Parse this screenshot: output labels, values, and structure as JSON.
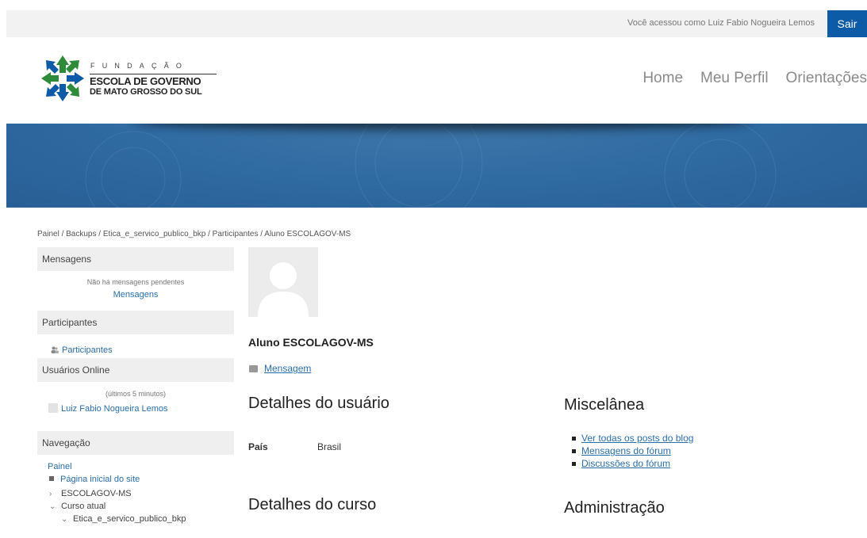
{
  "topbar": {
    "logged_in_text": "Você acessou como Luiz Fabio Nogueira Lemos",
    "logout_label": "Sair"
  },
  "logo": {
    "line_fundacao": "FUNDAÇÃO",
    "line_escola": "ESCOLA DE GOVERNO",
    "line_mato": "DE MATO GROSSO DO SUL"
  },
  "nav": {
    "home": "Home",
    "profile": "Meu Perfil",
    "guidance": "Orientações"
  },
  "breadcrumb": "Painel / Backups / Etica_e_servico_publico_bkp / Participantes / Aluno ESCOLAGOV-MS",
  "sidebar": {
    "messages": {
      "title": "Mensagens",
      "empty_text": "Não há mensagens pendentes",
      "link": "Mensagens"
    },
    "participants": {
      "title": "Participantes",
      "link": "Participantes"
    },
    "online": {
      "title": "Usuários Online",
      "window_text": "(últimos 5 minutos)",
      "user": "Luiz Fabio Nogueira Lemos"
    },
    "navigation": {
      "title": "Navegação",
      "root": "Painel",
      "home": "Página inicial do site",
      "escolagov": "ESCOLAGOV-MS",
      "current_course": "Curso atual",
      "course": "Etica_e_servico_publico_bkp"
    }
  },
  "profile": {
    "name": "Aluno ESCOLAGOV-MS",
    "message_link": "Mensagem",
    "user_details_title": "Detalhes do usuário",
    "country_label": "País",
    "country_value": "Brasil",
    "course_details_title": "Detalhes do curso"
  },
  "misc": {
    "title": "Miscelânea",
    "links": [
      "Ver todas os posts do blog",
      "Mensagens do fórum",
      "Discussões do fórum"
    ],
    "admin_title": "Administração"
  },
  "colors": {
    "accent": "#0d5aa7",
    "banner": "#2f6aa1",
    "link": "#2a6ea8"
  }
}
